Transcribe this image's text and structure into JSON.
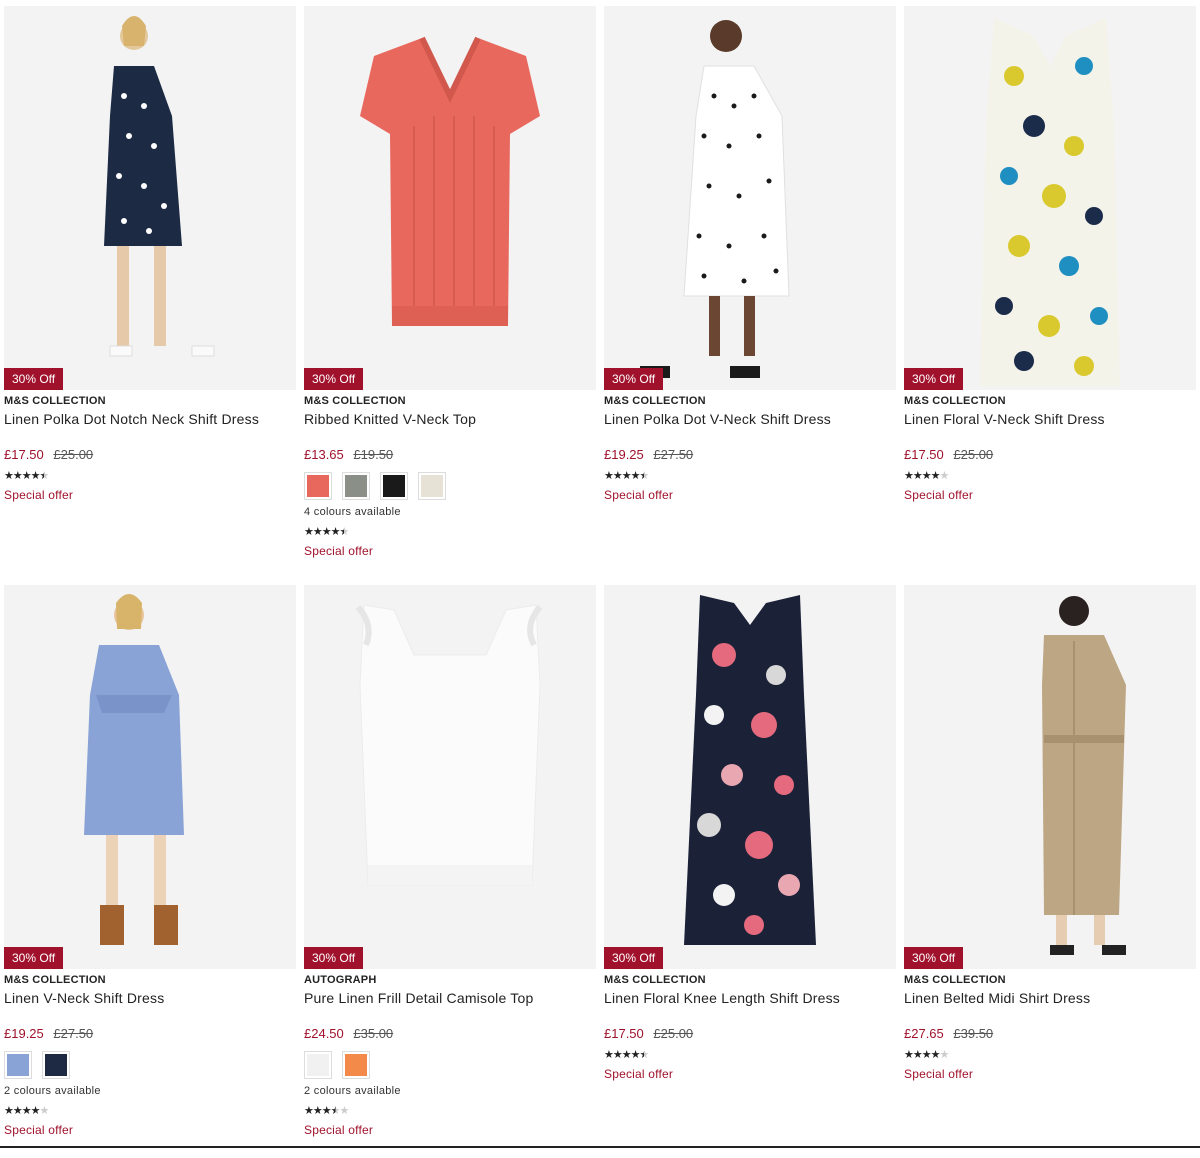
{
  "products": [
    {
      "badge": "30% Off",
      "brand": "M&S COLLECTION",
      "title": "Linen Polka Dot Notch Neck Shift Dress",
      "price_now": "£17.50",
      "price_was": "£25.00",
      "rating": 4.5,
      "offer": "Special offer",
      "swatches": [],
      "colours_text": ""
    },
    {
      "badge": "30% Off",
      "brand": "M&S COLLECTION",
      "title": "Ribbed Knitted V-Neck Top",
      "price_now": "£13.65",
      "price_was": "£19.50",
      "rating": 4.5,
      "offer": "Special offer",
      "swatches": [
        "#e8685d",
        "#8a9088",
        "#1a1a1a",
        "#e7e2d6"
      ],
      "colours_text": "4 colours available"
    },
    {
      "badge": "30% Off",
      "brand": "M&S COLLECTION",
      "title": "Linen Polka Dot V-Neck Shift Dress",
      "price_now": "£19.25",
      "price_was": "£27.50",
      "rating": 4.5,
      "offer": "Special offer",
      "swatches": [],
      "colours_text": ""
    },
    {
      "badge": "30% Off",
      "brand": "M&S COLLECTION",
      "title": "Linen Floral V-Neck Shift Dress",
      "price_now": "£17.50",
      "price_was": "£25.00",
      "rating": 4,
      "offer": "Special offer",
      "swatches": [],
      "colours_text": ""
    },
    {
      "badge": "30% Off",
      "brand": "M&S COLLECTION",
      "title": "Linen V-Neck Shift Dress",
      "price_now": "£19.25",
      "price_was": "£27.50",
      "rating": 4,
      "offer": "Special offer",
      "swatches": [
        "#8aa3d6",
        "#1e2a44"
      ],
      "colours_text": "2 colours available"
    },
    {
      "badge": "30% Off",
      "brand": "AUTOGRAPH",
      "title": "Pure Linen Frill Detail Camisole Top",
      "price_now": "£24.50",
      "price_was": "£35.00",
      "rating": 3.5,
      "offer": "Special offer",
      "swatches": [
        "#f1f1f1",
        "#f38a4a"
      ],
      "colours_text": "2 colours available"
    },
    {
      "badge": "30% Off",
      "brand": "M&S COLLECTION",
      "title": "Linen Floral Knee Length Shift Dress",
      "price_now": "£17.50",
      "price_was": "£25.00",
      "rating": 4.5,
      "offer": "Special offer",
      "swatches": [],
      "colours_text": ""
    },
    {
      "badge": "30% Off",
      "brand": "M&S COLLECTION",
      "title": "Linen Belted Midi Shirt Dress",
      "price_now": "£27.65",
      "price_was": "£39.50",
      "rating": 4,
      "offer": "Special offer",
      "swatches": [],
      "colours_text": ""
    }
  ],
  "colors": {
    "sale_red": "#a0122c",
    "image_bg": "#f2f2f2"
  }
}
